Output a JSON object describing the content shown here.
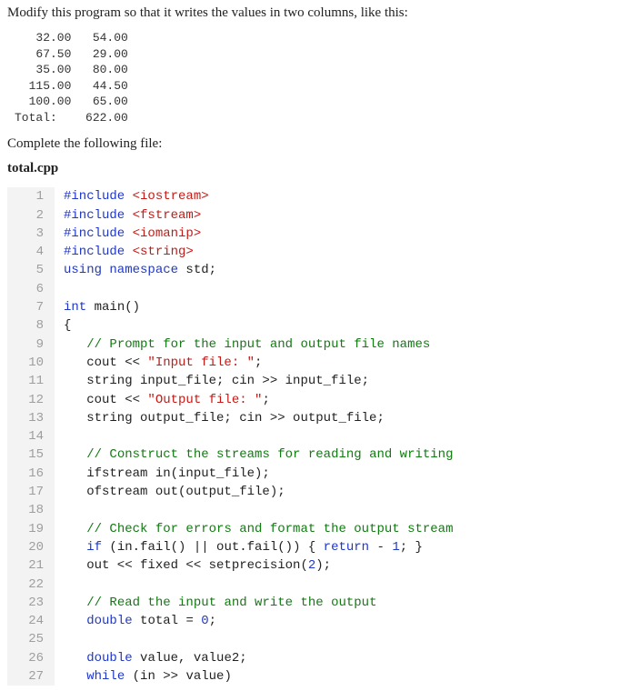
{
  "prompt": "Modify this program so that it writes the values in two columns, like this:",
  "sample_output": [
    "   32.00   54.00",
    "   67.50   29.00",
    "   35.00   80.00",
    "  115.00   44.50",
    "  100.00   65.00",
    "Total:    622.00"
  ],
  "complete_text": "Complete the following file:",
  "filename": "total.cpp",
  "code": [
    {
      "n": 1,
      "tokens": [
        {
          "c": "kw",
          "t": "#include "
        },
        {
          "c": "pp",
          "t": "<iostream>"
        }
      ]
    },
    {
      "n": 2,
      "tokens": [
        {
          "c": "kw",
          "t": "#include "
        },
        {
          "c": "pp",
          "t": "<fstream>"
        }
      ]
    },
    {
      "n": 3,
      "tokens": [
        {
          "c": "kw",
          "t": "#include "
        },
        {
          "c": "pp",
          "t": "<iomanip>"
        }
      ]
    },
    {
      "n": 4,
      "tokens": [
        {
          "c": "kw",
          "t": "#include "
        },
        {
          "c": "pp",
          "t": "<string>"
        }
      ]
    },
    {
      "n": 5,
      "tokens": [
        {
          "c": "kw",
          "t": "using namespace "
        },
        {
          "c": "",
          "t": "std;"
        }
      ]
    },
    {
      "n": 6,
      "tokens": [
        {
          "c": "",
          "t": ""
        }
      ]
    },
    {
      "n": 7,
      "tokens": [
        {
          "c": "kw",
          "t": "int "
        },
        {
          "c": "",
          "t": "main()"
        }
      ]
    },
    {
      "n": 8,
      "tokens": [
        {
          "c": "",
          "t": "{"
        }
      ]
    },
    {
      "n": 9,
      "tokens": [
        {
          "c": "",
          "t": "   "
        },
        {
          "c": "cmt",
          "t": "// Prompt for the input and output file names"
        }
      ]
    },
    {
      "n": 10,
      "tokens": [
        {
          "c": "",
          "t": "   cout << "
        },
        {
          "c": "str",
          "t": "\"Input file: \""
        },
        {
          "c": "",
          "t": ";"
        }
      ]
    },
    {
      "n": 11,
      "tokens": [
        {
          "c": "",
          "t": "   string input_file; cin >> input_file;"
        }
      ]
    },
    {
      "n": 12,
      "tokens": [
        {
          "c": "",
          "t": "   cout << "
        },
        {
          "c": "str",
          "t": "\"Output file: \""
        },
        {
          "c": "",
          "t": ";"
        }
      ]
    },
    {
      "n": 13,
      "tokens": [
        {
          "c": "",
          "t": "   string output_file; cin >> output_file;"
        }
      ]
    },
    {
      "n": 14,
      "tokens": [
        {
          "c": "",
          "t": ""
        }
      ]
    },
    {
      "n": 15,
      "tokens": [
        {
          "c": "",
          "t": "   "
        },
        {
          "c": "cmt",
          "t": "// Construct the streams for reading and writing"
        }
      ]
    },
    {
      "n": 16,
      "tokens": [
        {
          "c": "",
          "t": "   ifstream in(input_file);"
        }
      ]
    },
    {
      "n": 17,
      "tokens": [
        {
          "c": "",
          "t": "   ofstream out(output_file);"
        }
      ]
    },
    {
      "n": 18,
      "tokens": [
        {
          "c": "",
          "t": ""
        }
      ]
    },
    {
      "n": 19,
      "tokens": [
        {
          "c": "",
          "t": "   "
        },
        {
          "c": "cmt",
          "t": "// Check for errors and format the output stream"
        }
      ]
    },
    {
      "n": 20,
      "tokens": [
        {
          "c": "",
          "t": "   "
        },
        {
          "c": "kw",
          "t": "if"
        },
        {
          "c": "",
          "t": " (in.fail() || out.fail()) { "
        },
        {
          "c": "kw",
          "t": "return"
        },
        {
          "c": "",
          "t": " - "
        },
        {
          "c": "num",
          "t": "1"
        },
        {
          "c": "",
          "t": "; }"
        }
      ]
    },
    {
      "n": 21,
      "tokens": [
        {
          "c": "",
          "t": "   out << fixed << setprecision("
        },
        {
          "c": "num",
          "t": "2"
        },
        {
          "c": "",
          "t": ");"
        }
      ]
    },
    {
      "n": 22,
      "tokens": [
        {
          "c": "",
          "t": ""
        }
      ]
    },
    {
      "n": 23,
      "tokens": [
        {
          "c": "",
          "t": "   "
        },
        {
          "c": "cmt",
          "t": "// Read the input and write the output"
        }
      ]
    },
    {
      "n": 24,
      "tokens": [
        {
          "c": "",
          "t": "   "
        },
        {
          "c": "kw",
          "t": "double"
        },
        {
          "c": "",
          "t": " total = "
        },
        {
          "c": "num",
          "t": "0"
        },
        {
          "c": "",
          "t": ";"
        }
      ]
    },
    {
      "n": 25,
      "tokens": [
        {
          "c": "",
          "t": ""
        }
      ]
    },
    {
      "n": 26,
      "tokens": [
        {
          "c": "",
          "t": "   "
        },
        {
          "c": "kw",
          "t": "double"
        },
        {
          "c": "",
          "t": " value, value2;"
        }
      ]
    },
    {
      "n": 27,
      "tokens": [
        {
          "c": "",
          "t": "   "
        },
        {
          "c": "kw",
          "t": "while"
        },
        {
          "c": "",
          "t": " (in >> value)"
        }
      ]
    }
  ]
}
